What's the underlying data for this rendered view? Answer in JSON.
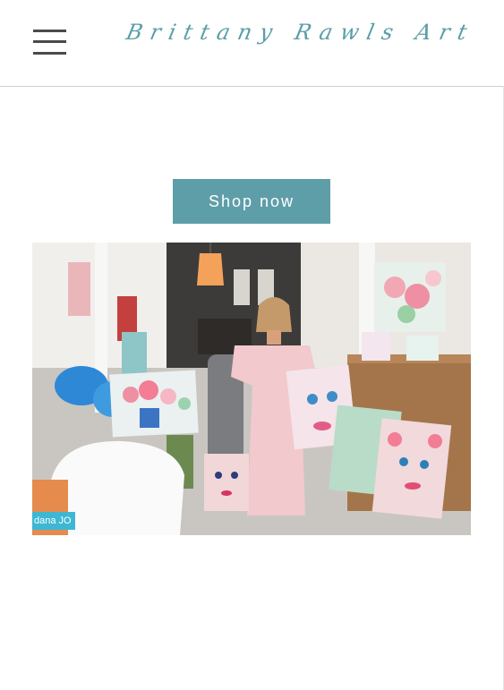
{
  "header": {
    "menu_icon": "hamburger-menu-icon",
    "site_title": "Brittany Rawls Art"
  },
  "main": {
    "shop_button_label": "Shop now",
    "hero_image": {
      "description": "Artist seated among colorful floral and portrait paintings in a boutique",
      "watermark_text": "dana JO"
    }
  },
  "colors": {
    "accent": "#5e9ea9",
    "logo": "#5a9ea8",
    "divider": "#cfcfcf"
  }
}
